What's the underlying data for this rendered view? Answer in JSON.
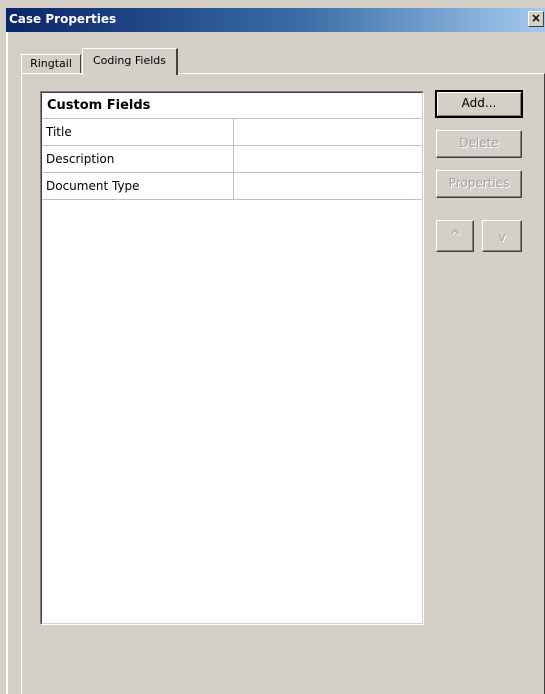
{
  "window": {
    "title": "Case Properties",
    "close_glyph": "×"
  },
  "tabs": [
    {
      "label": "Ringtail",
      "selected": false
    },
    {
      "label": "Coding Fields",
      "selected": true
    }
  ],
  "custom_fields": {
    "header": "Custom Fields",
    "rows": [
      {
        "name": "Title",
        "value": ""
      },
      {
        "name": "Description",
        "value": ""
      },
      {
        "name": "Document Type",
        "value": ""
      }
    ]
  },
  "buttons": {
    "add": "Add...",
    "delete": "Delete",
    "properties": "Properties",
    "move_up": "^",
    "move_down": "v"
  },
  "colors": {
    "titlebar_start": "#0a246a",
    "titlebar_end": "#a6caf0",
    "face": "#d4d0c8"
  }
}
